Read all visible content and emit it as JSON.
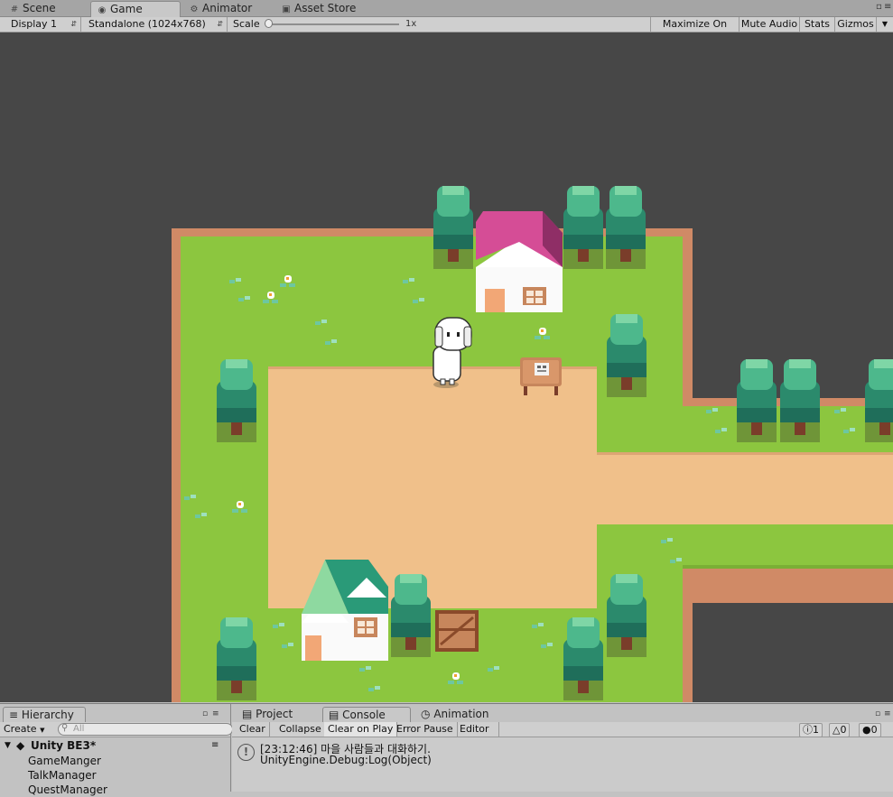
{
  "tabs": [
    {
      "id": "scene",
      "label": "Scene",
      "icon": "grid-icon"
    },
    {
      "id": "game",
      "label": "Game",
      "icon": "game-controller-icon",
      "active": true
    },
    {
      "id": "animator",
      "label": "Animator",
      "icon": "animator-icon"
    },
    {
      "id": "asset_store",
      "label": "Asset Store",
      "icon": "shopping-bag-icon"
    }
  ],
  "game_toolbar": {
    "display": "Display 1",
    "resolution": "Standalone (1024x768)",
    "scale_label": "Scale",
    "scale_value": "1x",
    "maximize": "Maximize On Play",
    "mute": "Mute Audio",
    "stats": "Stats",
    "gizmos": "Gizmos"
  },
  "hierarchy": {
    "tab_label": "Hierarchy",
    "create": "Create",
    "search_placeholder": "All",
    "scene_name": "Unity BE3*",
    "items": [
      "GameManger",
      "TalkManager",
      "QuestManager"
    ]
  },
  "bottom_tabs": [
    {
      "id": "project",
      "label": "Project",
      "icon": "folder-icon"
    },
    {
      "id": "console",
      "label": "Console",
      "icon": "console-icon",
      "active": true
    },
    {
      "id": "animation",
      "label": "Animation",
      "icon": "clock-icon"
    }
  ],
  "console": {
    "clear": "Clear",
    "collapse": "Collapse",
    "clear_on_play": "Clear on Play",
    "error_pause": "Error Pause",
    "editor": "Editor",
    "counts": {
      "log": "1",
      "warning": "0",
      "error": "0"
    },
    "entries": [
      {
        "line1": "[23:12:46] 마을 사람들과 대화하기.",
        "line2": "UnityEngine.Debug:Log(Object)"
      }
    ]
  },
  "colors": {
    "grass": "#8cc63f",
    "path": "#f0c08a",
    "border": "#d08a66",
    "tree_top": "#3fa67e",
    "tree_dark": "#1f6e5a",
    "roof_pink": "#d54d96",
    "roof_green": "#2a9a78",
    "background": "#474747"
  }
}
